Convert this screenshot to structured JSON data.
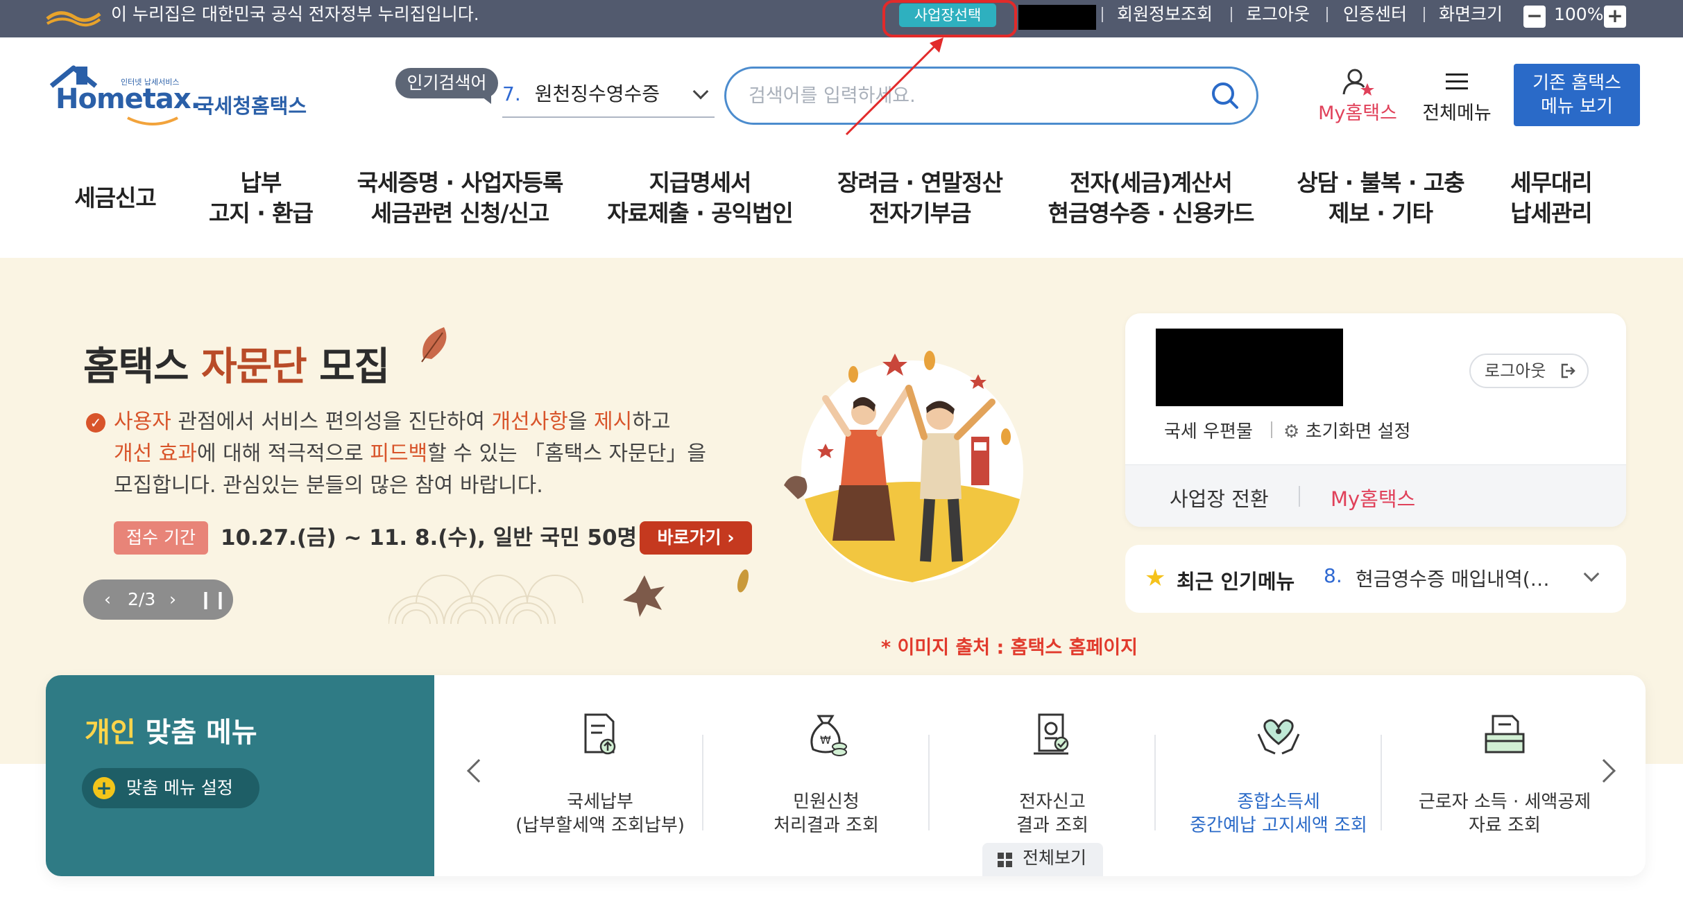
{
  "topbar": {
    "gov_notice": "이 누리집은 대한민국 공식 전자정부 누리집입니다.",
    "business_select": "사업장선택",
    "links": [
      "회원정보조회",
      "로그아웃",
      "인증센터"
    ],
    "zoom_label": "화면크기",
    "zoom_minus": "−",
    "zoom_value": "100%",
    "zoom_plus": "+"
  },
  "header": {
    "logo_small": "인터넷 납세서비스",
    "logo_main": "Hometax.",
    "logo_kr": "국세청홈택스",
    "popular_label": "인기검색어",
    "popular_rank": "7.",
    "popular_keyword": "원천징수영수증",
    "search_placeholder": "검색어를 입력하세요.",
    "my_hometax": "My홈택스",
    "full_menu": "전체메뉴",
    "legacy_line1": "기존 홈택스",
    "legacy_line2": "메뉴 보기"
  },
  "nav": [
    {
      "line1": "세금신고",
      "line2": ""
    },
    {
      "line1": "납부",
      "line2": "고지 · 환급"
    },
    {
      "line1": "국세증명 · 사업자등록",
      "line2": "세금관련 신청/신고"
    },
    {
      "line1": "지급명세서",
      "line2": "자료제출 · 공익법인"
    },
    {
      "line1": "장려금 · 연말정산",
      "line2": "전자기부금"
    },
    {
      "line1": "전자(세금)계산서",
      "line2": "현금영수증 · 신용카드"
    },
    {
      "line1": "상담 · 불복 · 고충",
      "line2": "제보 · 기타"
    },
    {
      "line1": "세무대리",
      "line2": "납세관리"
    }
  ],
  "banner": {
    "title_a": "홈택스 ",
    "title_b": "자문단",
    "title_c": " 모집",
    "body": [
      {
        "t": "사용자",
        "h": true
      },
      {
        "t": " 관점에서 서비스 편의성을 진단하여 ",
        "h": false
      },
      {
        "t": "개선사항",
        "h": true
      },
      {
        "t": "을 ",
        "h": false
      },
      {
        "t": "제시",
        "h": true
      },
      {
        "t": "하고",
        "h": false
      },
      {
        "t": "개선 효과",
        "h": true,
        "br": true
      },
      {
        "t": "에 대해 적극적으로 ",
        "h": false
      },
      {
        "t": "피드백",
        "h": true
      },
      {
        "t": "할 수 있는 「홈택스 자문단」을",
        "h": false
      },
      {
        "t": "모집합니다. 관심있는 분들의 많은 참여 바랍니다.",
        "h": false,
        "br": true
      }
    ],
    "period_label": "접수 기간",
    "period_text": "10.27.(금) ~ 11. 8.(수), 일반 국민 50명 모집",
    "go_label": "바로가기 ›",
    "pager": "2/3",
    "caption": "* 이미지 출처 : 홈택스 홈페이지"
  },
  "user_card": {
    "logout": "로그아웃",
    "mail": "국세 우편물",
    "init_setting": "초기화면 설정",
    "switch_business": "사업장 전환",
    "my_hometax": "My홈택스"
  },
  "recent_menu": {
    "title": "최근 인기메뉴",
    "rank": "8.",
    "item": "현금영수증 매입내역(…"
  },
  "quick_menu": {
    "title_a": "개인",
    "title_b": " 맞춤 메뉴",
    "setting": "맞춤 메뉴 설정",
    "items": [
      {
        "l1": "국세납부",
        "l2": "(납부할세액 조회납부)",
        "icon": "tax-payment-icon"
      },
      {
        "l1": "민원신청",
        "l2": "처리결과 조회",
        "icon": "money-bag-icon"
      },
      {
        "l1": "전자신고",
        "l2": "결과 조회",
        "icon": "e-filing-icon"
      },
      {
        "l1": "종합소득세",
        "l2": "중간예납 고지세액 조회",
        "icon": "heart-hands-icon"
      },
      {
        "l1": "근로자 소득 · 세액공제",
        "l2": "자료 조회",
        "icon": "document-tray-icon"
      }
    ],
    "see_all": "전체보기"
  },
  "colors": {
    "topbar": "#525a6e",
    "accent_blue": "#2a6ac8",
    "teal": "#2f7b85",
    "banner_bg": "#faf4e3",
    "highlight_red": "#e22a2a"
  }
}
